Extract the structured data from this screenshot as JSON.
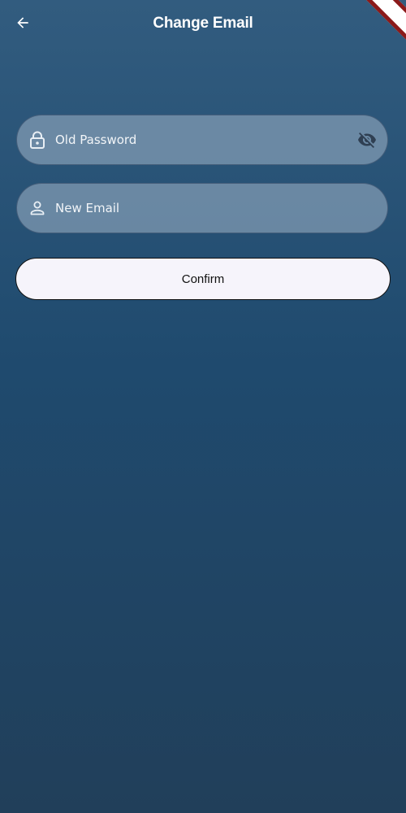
{
  "header": {
    "title": "Change Email",
    "back_icon": "arrow-left-icon"
  },
  "form": {
    "old_password": {
      "placeholder": "Old Password",
      "value": "",
      "leading_icon": "lock-icon",
      "trailing_icon": "visibility-off-icon"
    },
    "new_email": {
      "placeholder": "New Email",
      "value": "",
      "leading_icon": "person-icon"
    },
    "confirm_label": "Confirm"
  },
  "colors": {
    "background_top": "#325c7f",
    "background_bottom": "#213f5a",
    "field_fill": "#6f879f",
    "button_fill": "#f6f4fb",
    "debug_banner": "#8b1a1a"
  }
}
